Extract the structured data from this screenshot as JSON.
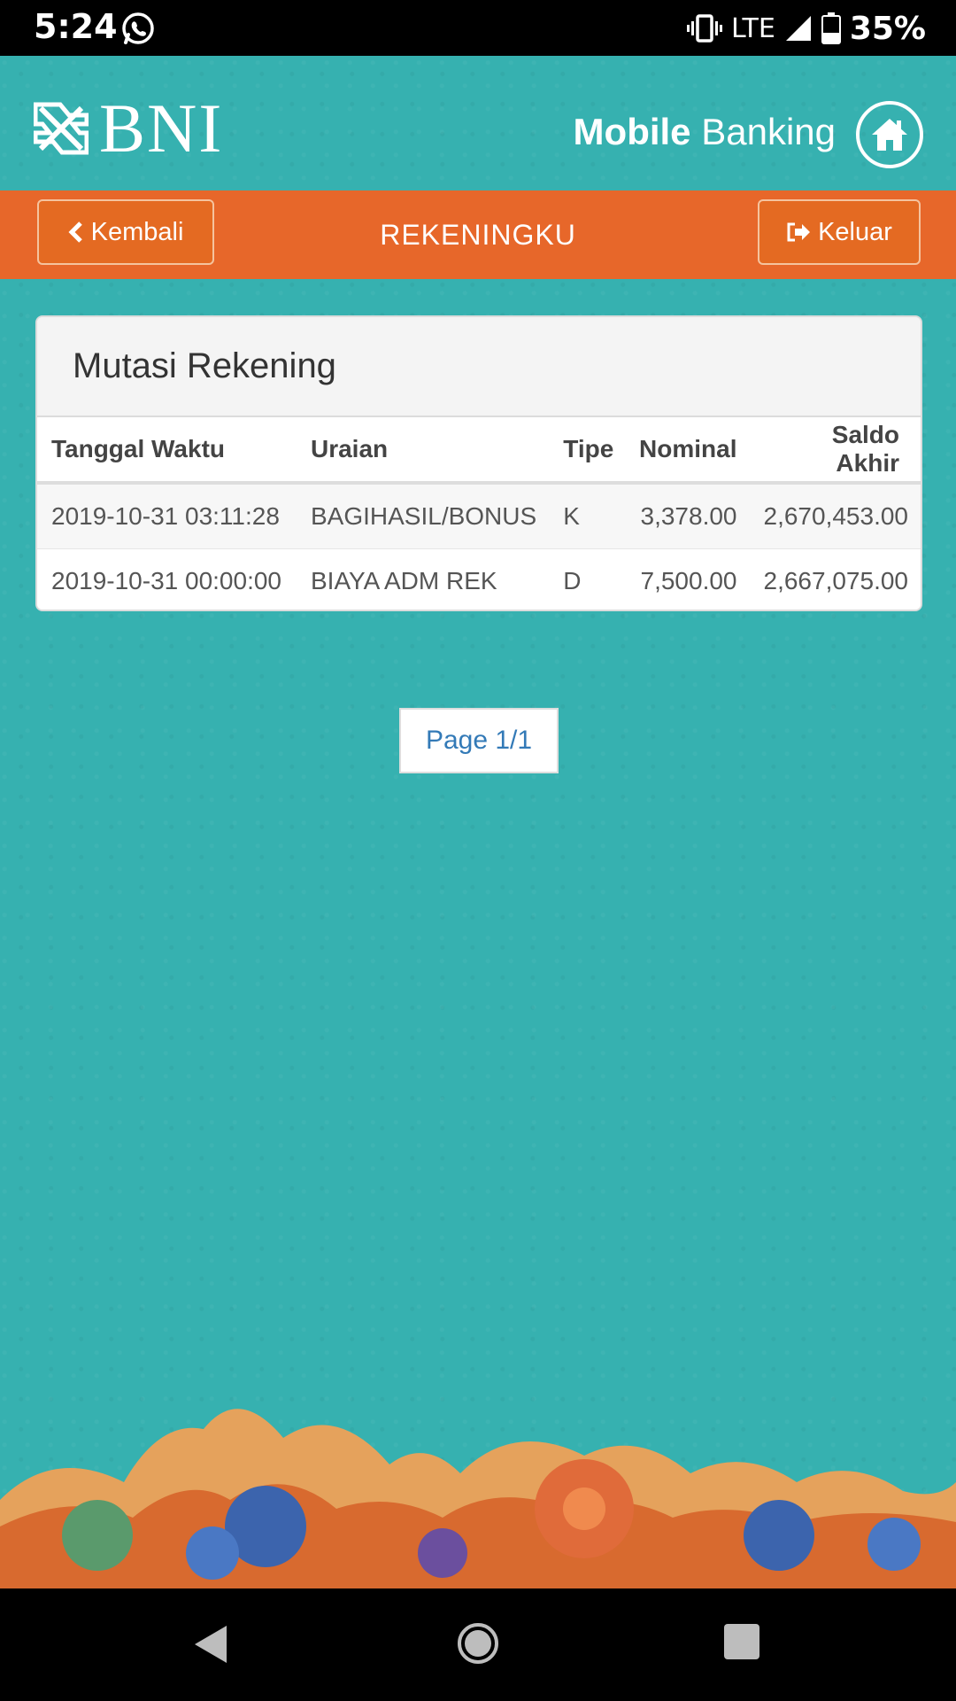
{
  "status_bar": {
    "time": "5:24",
    "network": "LTE",
    "battery": "35%"
  },
  "header": {
    "logo_text": "BNI",
    "title_bold": "Mobile",
    "title_rest": "Banking"
  },
  "nav": {
    "back_label": "Kembali",
    "page_title": "REKENINGKU",
    "logout_label": "Keluar"
  },
  "panel": {
    "title": "Mutasi Rekening",
    "columns": [
      "Tanggal Waktu",
      "Uraian",
      "Tipe",
      "Nominal",
      "Saldo Akhir"
    ],
    "rows": [
      [
        "2019-10-31 03:11:28",
        "BAGIHASIL/BONUS",
        "K",
        "3,378.00",
        "2,670,453.00"
      ],
      [
        "2019-10-31 00:00:00",
        "BIAYA ADM REK",
        "D",
        "7,500.00",
        "2,667,075.00"
      ]
    ]
  },
  "pager": {
    "label": "Page 1/1"
  },
  "colors": {
    "background": "#36b1b0",
    "accent": "#e7672a",
    "link": "#337ab7"
  }
}
